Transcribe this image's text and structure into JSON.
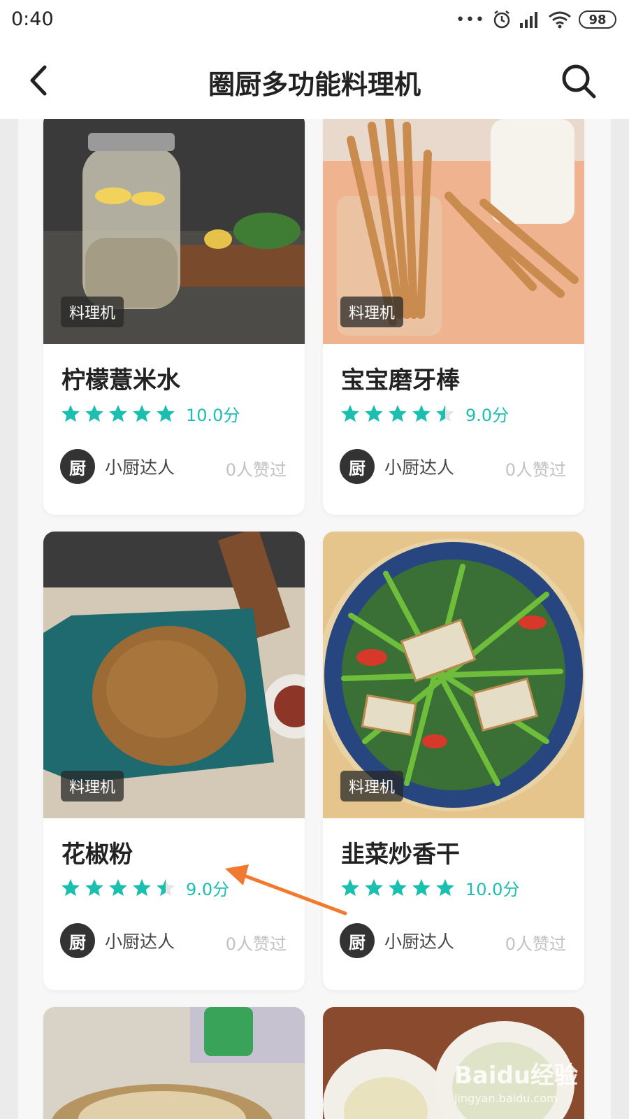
{
  "status_bar": {
    "time": "0:40",
    "battery": "98"
  },
  "header": {
    "title": "圈厨多功能料理机"
  },
  "recipes": [
    {
      "tag": "料理机",
      "name": "柠檬薏米水",
      "rating": 10.0,
      "score": "10.0分",
      "author": "小厨达人",
      "avatar_text": "厨",
      "likes": "0人赞过"
    },
    {
      "tag": "料理机",
      "name": "宝宝磨牙棒",
      "rating": 9.0,
      "score": "9.0分",
      "author": "小厨达人",
      "avatar_text": "厨",
      "likes": "0人赞过"
    },
    {
      "tag": "料理机",
      "name": "花椒粉",
      "rating": 9.0,
      "score": "9.0分",
      "author": "小厨达人",
      "avatar_text": "厨",
      "likes": "0人赞过"
    },
    {
      "tag": "料理机",
      "name": "韭菜炒香干",
      "rating": 10.0,
      "score": "10.0分",
      "author": "小厨达人",
      "avatar_text": "厨",
      "likes": "0人赞过"
    }
  ],
  "watermark": {
    "line1": "Baidu经验",
    "line2": "jingyan.baidu.com"
  },
  "colors": {
    "accent": "#1bbfb0",
    "arrow": "#f07a2f"
  }
}
